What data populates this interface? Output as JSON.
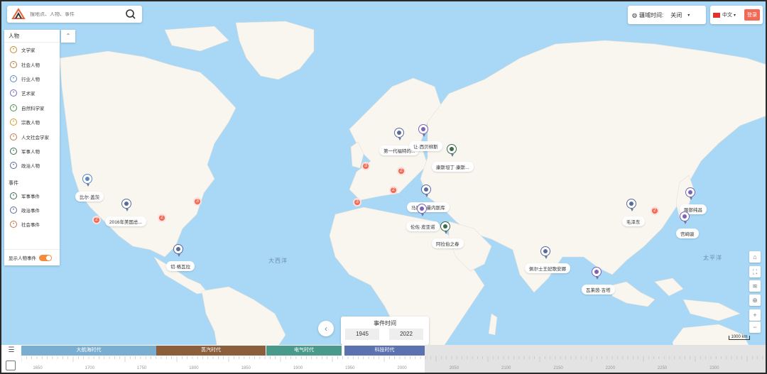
{
  "search": {
    "placeholder": "搜地点、人物、事件",
    "icon": "search-icon"
  },
  "panel": {
    "person_header": "人物",
    "collapse_icon": "chevron-up-icon",
    "persons": [
      {
        "label": "文学家",
        "color": "#c98d2b"
      },
      {
        "label": "社会人物",
        "color": "#b77b3d"
      },
      {
        "label": "行业人物",
        "color": "#5a86c4"
      },
      {
        "label": "艺术家",
        "color": "#7b64b8"
      },
      {
        "label": "自然科学家",
        "color": "#4d8b4a"
      },
      {
        "label": "宗教人物",
        "color": "#d19a2a"
      },
      {
        "label": "人文社会学家",
        "color": "#c4754d"
      },
      {
        "label": "军事人物",
        "color": "#3b6b4a"
      },
      {
        "label": "政治人物",
        "color": "#5a6b9a"
      }
    ],
    "event_header": "事件",
    "events": [
      {
        "label": "军事事件",
        "color": "#3b6b4a"
      },
      {
        "label": "政治事件",
        "color": "#5a6b9a"
      },
      {
        "label": "社会事件",
        "color": "#c4754d"
      }
    ],
    "toggle_label": "显示人物事件"
  },
  "topbar": {
    "territory_label": "疆域时间:",
    "territory_value": "关闭",
    "lang": "中文",
    "login": "登录"
  },
  "ocean_labels": {
    "atlantic": "大西洋",
    "pacific": "太平洋"
  },
  "pins": [
    {
      "label": "比尔·盖茨",
      "color": "#5a86c4"
    },
    {
      "label": "2016年美国总...",
      "color": "#5a6b9a"
    },
    {
      "label": "切·格瓦拉",
      "color": "#5a6b9a"
    },
    {
      "label": "第一代福特的...",
      "color": "#5a6b9a"
    },
    {
      "label": "让·西贝柳斯",
      "color": "#7b64b8"
    },
    {
      "label": "康斯坦丁·康斯...",
      "color": "#3b6b4a"
    },
    {
      "label": "马尼亚·曼内斯库",
      "color": "#5a6b9a"
    },
    {
      "label": "伦佐·皮亚诺",
      "color": "#7b64b8"
    },
    {
      "label": "阿拉伯之春",
      "color": "#3b6b4a"
    },
    {
      "label": "毛泽东",
      "color": "#5a6b9a"
    },
    {
      "label": "佩尔士王妃歌安娜",
      "color": "#5a6b9a"
    },
    {
      "label": "瓦莱茵·吉塔",
      "color": "#7b64b8"
    },
    {
      "label": "服部纯昌",
      "color": "#7b64b8"
    },
    {
      "label": "宫崎骏",
      "color": "#7b64b8"
    }
  ],
  "clusters": [
    "3",
    "2",
    "2",
    "3",
    "2",
    "2",
    "3",
    "2"
  ],
  "event_time": {
    "title": "事件时间",
    "start": "1945",
    "end": "2022"
  },
  "scale": "1000 km",
  "eras": [
    {
      "label": "大航海时代",
      "color": "#7aaed0"
    },
    {
      "label": "蒸汽时代",
      "color": "#8b5e3c"
    },
    {
      "label": "电气时代",
      "color": "#4a9a8c"
    },
    {
      "label": "科技时代",
      "color": "#5a72b0"
    }
  ],
  "ticks": [
    "1650",
    "1700",
    "1750",
    "1800",
    "1850",
    "1900",
    "1950",
    "2000",
    "2050",
    "2100",
    "2150",
    "2200",
    "2250",
    "2300"
  ],
  "right_controls": [
    "tag-icon",
    "fullscreen-icon",
    "layers-icon",
    "locate-icon",
    "zoom-in-icon",
    "zoom-out-icon"
  ]
}
